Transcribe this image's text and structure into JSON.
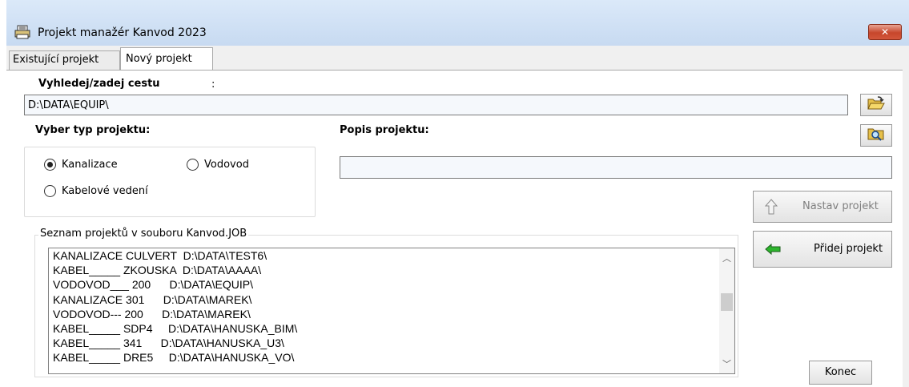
{
  "window": {
    "title": "Projekt manažér Kanvod 2023",
    "close_label": "✕"
  },
  "tabs": [
    {
      "label": "Existující projekt",
      "selected": false
    },
    {
      "label": "Nový projekt",
      "selected": true
    }
  ],
  "path": {
    "label": "Vyhledej/zadej cestu",
    "colon": ":",
    "value": "D:\\DATA\\EQUIP\\"
  },
  "project_type": {
    "label": "Vyber typ projektu:",
    "options": [
      {
        "label": "Kanalizace",
        "checked": true
      },
      {
        "label": "Vodovod",
        "checked": false
      },
      {
        "label": "Kabelové vedení",
        "checked": false
      }
    ]
  },
  "description": {
    "label": "Popis projektu:",
    "value": ""
  },
  "buttons": {
    "set_project": "Nastav projekt",
    "add_project": "Přidej projekt",
    "exit": "Konec"
  },
  "project_list": {
    "title": "Seznam projektů v souboru Kanvod.JOB",
    "items": [
      "KANALIZACE CULVERT  D:\\DATA\\TEST6\\",
      "KABEL_____ ZKOUSKA  D:\\DATA\\AAAA\\",
      "VODOVOD___ 200      D:\\DATA\\EQUIP\\",
      "KANALIZACE 301      D:\\DATA\\MAREK\\",
      "VODOVOD--- 200      D:\\DATA\\MAREK\\",
      "KABEL_____ SDP4     D:\\DATA\\HANUSKA_BIM\\",
      "KABEL_____ 341      D:\\DATA\\HANUSKA_U3\\",
      "KABEL_____ DRE5     D:\\DATA\\HANUSKA_VO\\"
    ]
  },
  "icons": {
    "app": "printer-icon",
    "browse": "open-folder-icon",
    "search": "folder-search-icon",
    "up": "up-arrow-icon",
    "add": "left-arrow-icon"
  },
  "colors": {
    "titlebar": "#c7daf1",
    "close": "#c7462b",
    "add_arrow": "#2db52d"
  }
}
